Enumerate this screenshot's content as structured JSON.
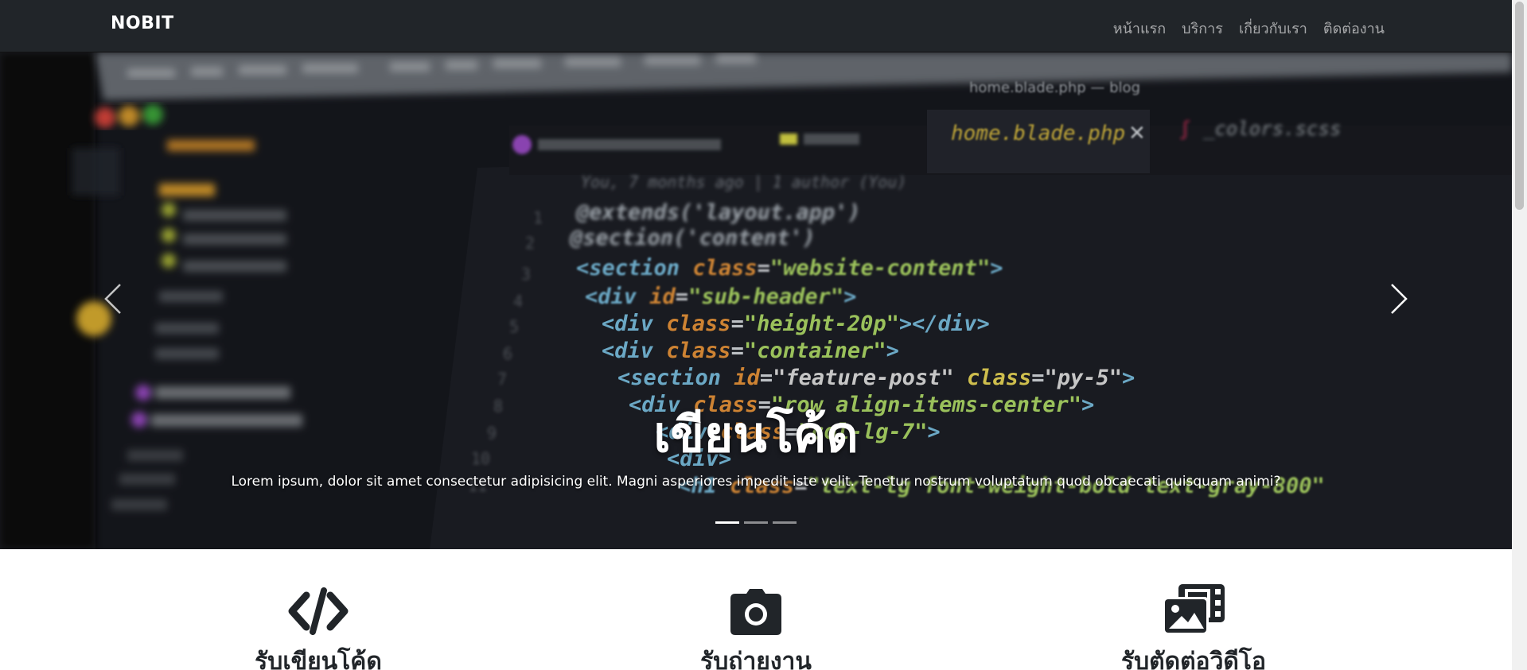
{
  "navbar": {
    "brand": "NOBIT",
    "links": [
      "หน้าแรก",
      "บริการ",
      "เกี่ยวกับเรา",
      "ติดต่องาน"
    ]
  },
  "hero": {
    "title": "เขียนโค้ด",
    "text": "Lorem ipsum, dolor sit amet consectetur adipisicing elit. Magni asperiores impedit iste velit. Tenetur nostrum voluptatum quod obcaecati quisquam animi?",
    "prev_icon": "chevron-left-icon",
    "next_icon": "chevron-right-icon",
    "slides": 3,
    "active_slide": 1,
    "background": {
      "window_title": "home.blade.php — blog",
      "tabs": [
        "RegisterController.php",
        "app.js",
        "home.blade.php",
        "_colors.scss"
      ],
      "git_blame": "You, 7 months ago | 1 author (You)",
      "code_lines": [
        "@extends('layout.app')",
        "@section('content')",
        "<section class=\"website-content\">",
        "<div id=\"sub-header\">",
        "<div class=\"height-20p\"></div>",
        "<div class=\"container\">",
        "<section id=\"feature-post\" class=\"py-5\">",
        "<div class=\"row align-items-center\">",
        "<div class=\"col-lg-7\">",
        "<div>",
        "<h1 class=\"text-lg font-weight-bold text-gray-800\">"
      ],
      "line_numbers": [
        "1",
        "2",
        "3",
        "4",
        "5",
        "6",
        "7",
        "8",
        "9",
        "10",
        "11"
      ]
    }
  },
  "services": [
    {
      "icon": "code-icon",
      "title": "รับเขียนโค้ด"
    },
    {
      "icon": "camera-icon",
      "title": "รับถ่ายงาน"
    },
    {
      "icon": "photo-film-icon",
      "title": "รับตัดต่อวิดีโอ"
    }
  ],
  "colors": {
    "navbar": "#212529",
    "hero_bg": "#15171e",
    "text_dark": "#212529"
  }
}
